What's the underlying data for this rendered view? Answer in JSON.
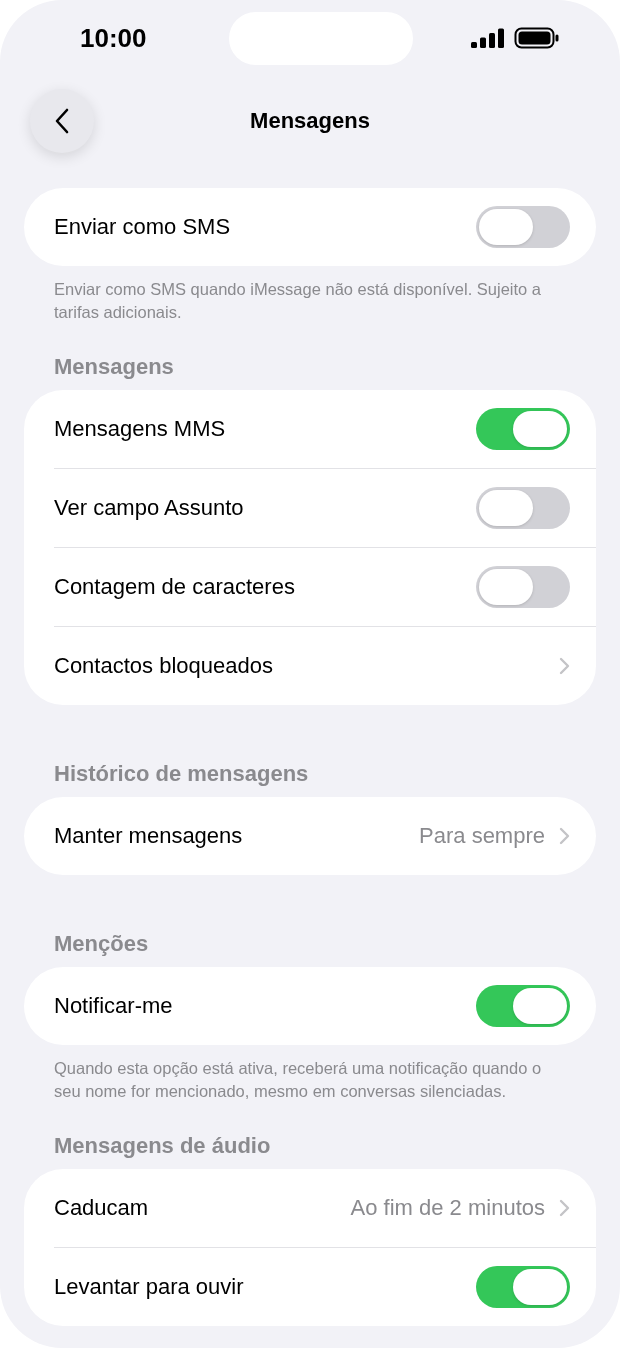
{
  "status_bar": {
    "time": "10:00"
  },
  "nav": {
    "title": "Mensagens"
  },
  "sections": [
    {
      "rows": [
        {
          "kind": "toggle",
          "label": "Enviar como SMS",
          "on": false
        }
      ],
      "footer": "Enviar como SMS quando iMessage não está disponível. Sujeito a tarifas adicionais."
    },
    {
      "header": "Mensagens",
      "rows": [
        {
          "kind": "toggle",
          "label": "Mensagens MMS",
          "on": true
        },
        {
          "kind": "toggle",
          "label": "Ver campo Assunto",
          "on": false
        },
        {
          "kind": "toggle",
          "label": "Contagem de caracteres",
          "on": false
        },
        {
          "kind": "link",
          "label": "Contactos bloqueados"
        }
      ]
    },
    {
      "header": "Histórico de mensagens",
      "rows": [
        {
          "kind": "link",
          "label": "Manter mensagens",
          "value": "Para sempre"
        }
      ]
    },
    {
      "header": "Menções",
      "rows": [
        {
          "kind": "toggle",
          "label": "Notificar-me",
          "on": true
        }
      ],
      "footer": "Quando esta opção está ativa, receberá uma notificação quando o seu nome for mencionado, mesmo em conversas silenciadas."
    },
    {
      "header": "Mensagens de áudio",
      "rows": [
        {
          "kind": "link",
          "label": "Caducam",
          "value": "Ao fim de 2 minutos"
        },
        {
          "kind": "toggle",
          "label": "Levantar para ouvir",
          "on": true
        }
      ]
    }
  ]
}
